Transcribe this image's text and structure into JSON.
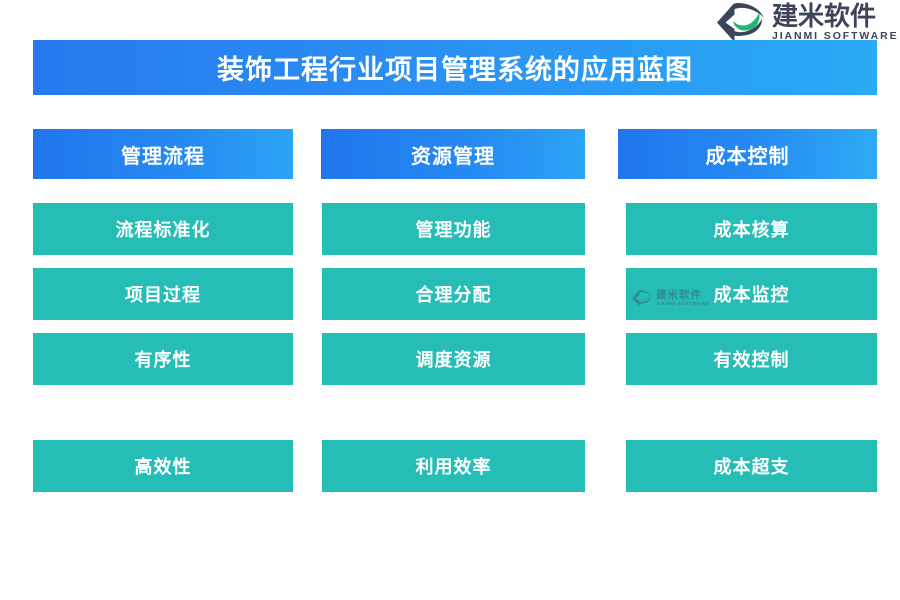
{
  "brand": {
    "mark_icon": "jianmi-leaf-logo-icon",
    "name_cn": "建米软件",
    "name_en": "JIANMI SOFTWARE",
    "mark_dark_color": "#3c4459",
    "mark_green_color": "#22b573"
  },
  "header": {
    "title": "装饰工程行业项目管理系统的应用蓝图",
    "gradient_start": "#2779ef",
    "gradient_end": "#29aaf6",
    "title_color": "#ffffff"
  },
  "theme": {
    "header_blue_start": "#2176ee",
    "header_blue_end": "#2ba4f5",
    "cell_teal": "#25bdb5",
    "text_white": "#ffffff",
    "page_background": "#ffffff"
  },
  "columns": [
    {
      "header": "管理流程",
      "cells": [
        "流程标准化",
        "项目过程",
        "有序性"
      ],
      "watermark_on": null
    },
    {
      "header": "资源管理",
      "cells": [
        "管理功能",
        "合理分配",
        "调度资源"
      ],
      "watermark_on": null
    },
    {
      "header": "成本控制",
      "cells": [
        "成本核算",
        "成本监控",
        "有效控制"
      ],
      "watermark_on": 1
    }
  ],
  "bottom_row": [
    "高效性",
    "利用效率",
    "成本超支"
  ],
  "watermark": {
    "name_cn": "建米软件",
    "name_en": "JIANMI SOFTWARE",
    "mark_icon": "jianmi-leaf-logo-icon"
  }
}
